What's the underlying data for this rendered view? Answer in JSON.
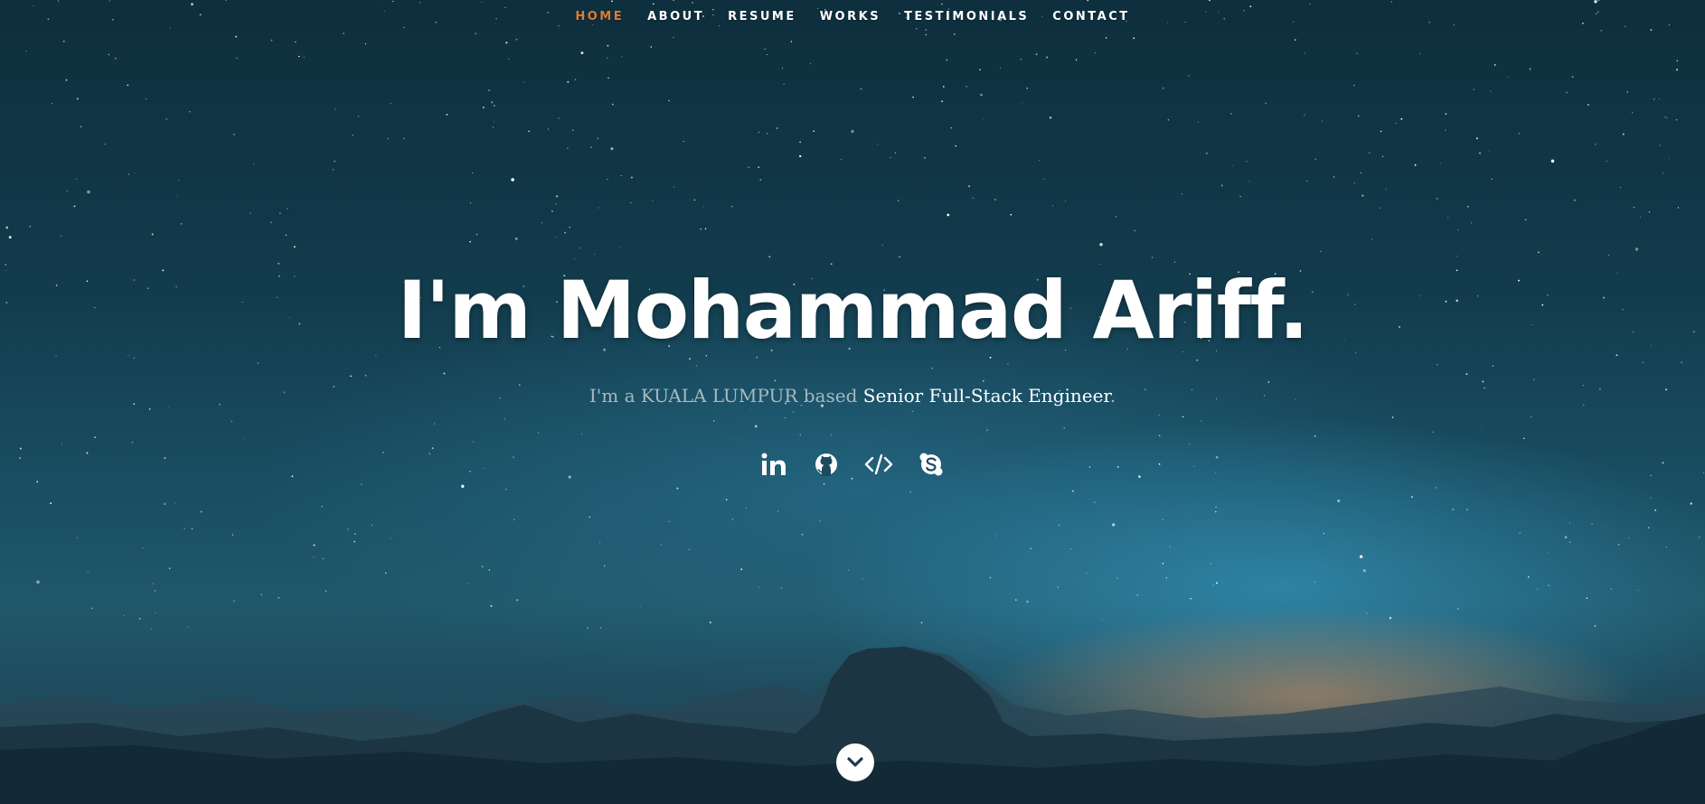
{
  "nav": {
    "items": [
      {
        "label": "HOME",
        "active": true
      },
      {
        "label": "ABOUT",
        "active": false
      },
      {
        "label": "RESUME",
        "active": false
      },
      {
        "label": "WORKS",
        "active": false
      },
      {
        "label": "TESTIMONIALS",
        "active": false
      },
      {
        "label": "CONTACT",
        "active": false
      }
    ]
  },
  "hero": {
    "headline": "I'm Mohammad Ariff.",
    "intro_prefix": "I'm a KUALA LUMPUR based ",
    "intro_role": "Senior Full-Stack Engineer",
    "intro_suffix": "."
  },
  "social": {
    "icons": [
      "linkedin-icon",
      "github-icon",
      "code-icon",
      "skype-icon"
    ]
  },
  "scroll_down": {
    "icon": "chevron-down-icon"
  },
  "colors": {
    "accent": "#e27a2d",
    "text": "#ffffff",
    "muted_text": "#a9b8bf",
    "sky_top": "#0e2f3d",
    "sky_glow": "#3aa5d0",
    "horizon_glow": "#e0935b"
  }
}
